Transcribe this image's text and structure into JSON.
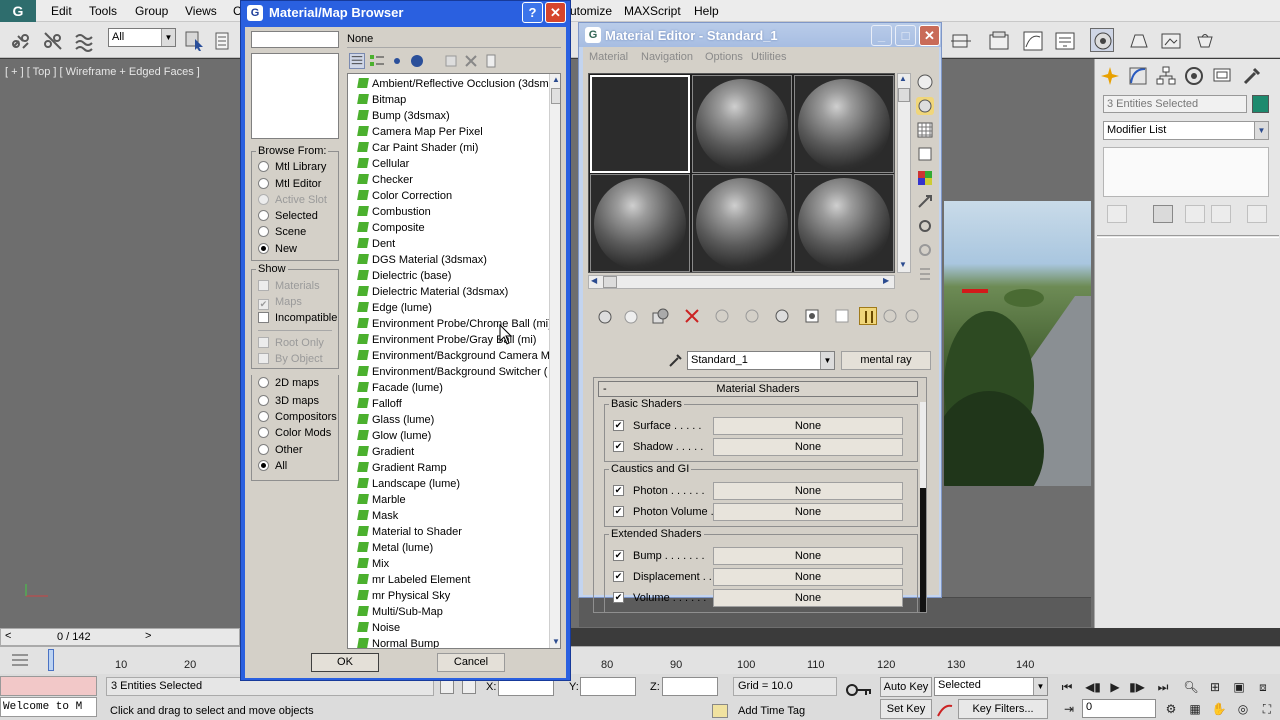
{
  "menubar": {
    "items": [
      "Edit",
      "Tools",
      "Group",
      "Views",
      "C",
      "utomize",
      "MAXScript",
      "Help"
    ]
  },
  "toolbar": {
    "selection_filter": "All"
  },
  "viewport": {
    "label": "[ + ] [ Top ] [ Wireframe + Edged Faces ]"
  },
  "command_panel": {
    "entities_field": "3 Entities Selected",
    "modifier_list": "Modifier List"
  },
  "mmb": {
    "title": "Material/Map Browser",
    "help_label": "?",
    "close_label": "X",
    "none_label": "None",
    "browse_from": {
      "legend": "Browse From:",
      "options": [
        {
          "label": "Mtl Library",
          "checked": false,
          "disabled": false
        },
        {
          "label": "Mtl Editor",
          "checked": false,
          "disabled": false
        },
        {
          "label": "Active Slot",
          "checked": false,
          "disabled": true
        },
        {
          "label": "Selected",
          "checked": false,
          "disabled": false
        },
        {
          "label": "Scene",
          "checked": false,
          "disabled": false
        },
        {
          "label": "New",
          "checked": true,
          "disabled": false
        }
      ]
    },
    "show": {
      "legend": "Show",
      "options": [
        {
          "label": "Materials",
          "checked": false,
          "disabled": true
        },
        {
          "label": "Maps",
          "checked": true,
          "disabled": true
        },
        {
          "label": "Incompatible",
          "checked": false,
          "disabled": false
        }
      ],
      "options2": [
        {
          "label": "Root Only",
          "checked": false,
          "disabled": true
        },
        {
          "label": "By Object",
          "checked": false,
          "disabled": true
        }
      ]
    },
    "categories": [
      {
        "label": "2D maps",
        "checked": false
      },
      {
        "label": "3D maps",
        "checked": false
      },
      {
        "label": "Compositors",
        "checked": false
      },
      {
        "label": "Color Mods",
        "checked": false
      },
      {
        "label": "Other",
        "checked": false
      },
      {
        "label": "All",
        "checked": true
      }
    ],
    "list_items": [
      "Ambient/Reflective Occlusion (3dsm",
      "Bitmap",
      "Bump (3dsmax)",
      "Camera Map Per Pixel",
      "Car Paint Shader (mi)",
      "Cellular",
      "Checker",
      "Color Correction",
      "Combustion",
      "Composite",
      "Dent",
      "DGS Material (3dsmax)",
      "Dielectric (base)",
      "Dielectric Material (3dsmax)",
      "Edge (lume)",
      "Environment Probe/Chrome Ball (mi)",
      "Environment Probe/Gray Ball (mi)",
      "Environment/Background Camera M",
      "Environment/Background Switcher (",
      "Facade (lume)",
      "Falloff",
      "Glass (lume)",
      "Glow (lume)",
      "Gradient",
      "Gradient Ramp",
      "Landscape (lume)",
      "Marble",
      "Mask",
      "Material to Shader",
      "Metal (lume)",
      "Mix",
      "mr Labeled Element",
      "mr Physical Sky",
      "Multi/Sub-Map",
      "Noise",
      "Normal Bump"
    ],
    "ok_label": "OK",
    "cancel_label": "Cancel"
  },
  "med": {
    "title": "Material Editor - Standard_1",
    "menus": [
      "Material",
      "Navigation",
      "Options",
      "Utilities"
    ],
    "material_name": "Standard_1",
    "material_type": "mental ray",
    "rollout_title": "Material Shaders",
    "groups": [
      {
        "legend": "Basic Shaders",
        "rows": [
          {
            "label": "Surface . . . . .",
            "value": "None"
          },
          {
            "label": "Shadow . . . . .",
            "value": "None"
          }
        ]
      },
      {
        "legend": "Caustics and GI",
        "rows": [
          {
            "label": "Photon . . . . . .",
            "value": "None"
          },
          {
            "label": "Photon Volume .",
            "value": "None"
          }
        ]
      },
      {
        "legend": "Extended Shaders",
        "rows": [
          {
            "label": "Bump . . . . . . .",
            "value": "None"
          },
          {
            "label": "Displacement . .",
            "value": "None"
          },
          {
            "label": "Volume . . . . . .",
            "value": "None"
          }
        ]
      }
    ]
  },
  "timeline": {
    "frame_counter": "0 / 142",
    "ticks": [
      "10",
      "20",
      "80",
      "90",
      "100",
      "110",
      "120",
      "130",
      "140"
    ]
  },
  "status": {
    "selection": "3 Entities Selected",
    "prompt": "Click and drag to select and move objects",
    "listener": "Welcome to M",
    "x_label": "X:",
    "y_label": "Y:",
    "z_label": "Z:",
    "grid": "Grid = 10.0",
    "add_time_tag": "Add Time Tag",
    "auto_key": "Auto Key",
    "set_key": "Set Key",
    "key_mode": "Selected",
    "key_filters": "Key Filters...",
    "current_frame": "0"
  }
}
